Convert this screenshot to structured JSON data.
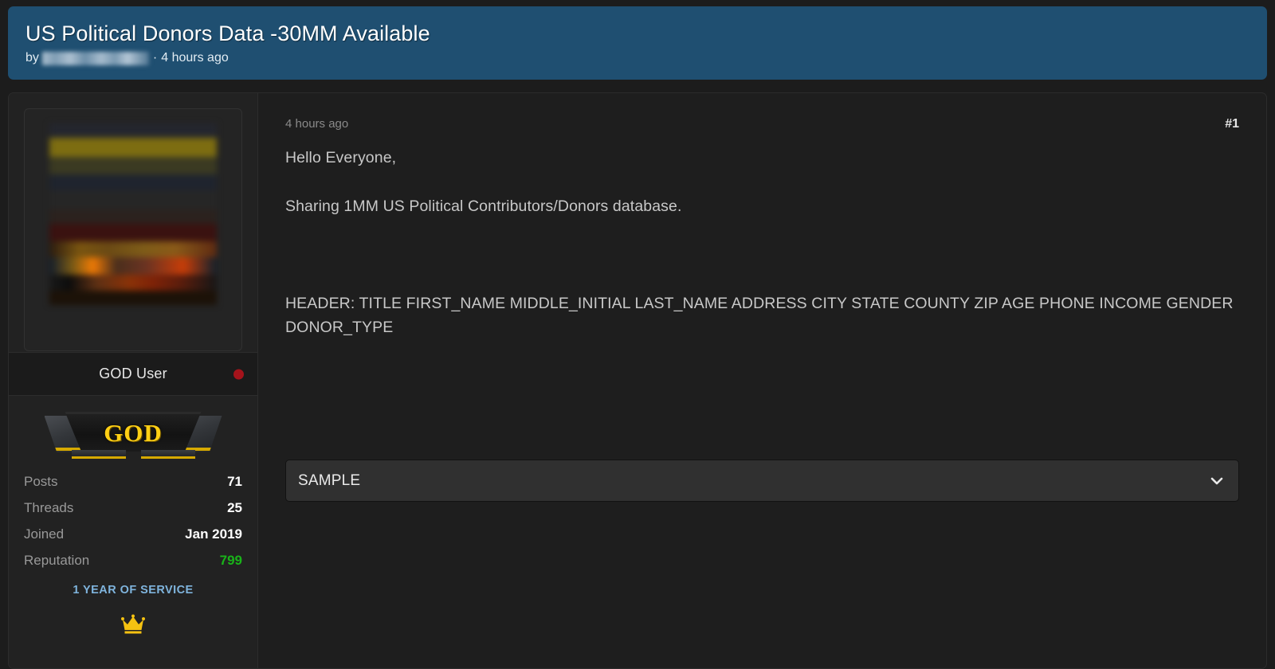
{
  "thread": {
    "title": "US Political Donors Data -30MM Available",
    "by_label": "by",
    "author_name_redacted": "",
    "separator": "·",
    "posted_ago": "4 hours ago"
  },
  "post": {
    "date": "4 hours ago",
    "number": "#1",
    "paragraphs": [
      "Hello Everyone,",
      "Sharing 1MM US Political Contributors/Donors database.",
      "HEADER: TITLE FIRST_NAME MIDDLE_INITIAL LAST_NAME ADDRESS CITY STATE COUNTY ZIP AGE PHONE INCOME GENDER DONOR_TYPE"
    ],
    "spoiler": {
      "label": "SAMPLE",
      "toggle_icon": "chevron-down-icon"
    }
  },
  "author": {
    "avatar_alt": "avatar-image",
    "rank_title": "GOD User",
    "status_icon": "offline-status-dot",
    "rank_badge_text": "GOD",
    "stats": [
      {
        "label": "Posts",
        "value": "71"
      },
      {
        "label": "Threads",
        "value": "25"
      },
      {
        "label": "Joined",
        "value": "Jan 2019"
      },
      {
        "label": "Reputation",
        "value": "799"
      }
    ],
    "service_badge": "1 YEAR OF SERVICE",
    "award_icon": "crown-icon"
  },
  "colors": {
    "header_blue": "#1f4f71",
    "page_bg": "#1c1c1c",
    "panel_bg": "#1e1e1e",
    "sidebar_bg": "#222222",
    "reputation_green": "#19b319",
    "service_blue": "#7fb4dd",
    "status_red": "#a5131b",
    "crown_gold": "#f5c211",
    "badge_gold": "#ffcf14"
  }
}
